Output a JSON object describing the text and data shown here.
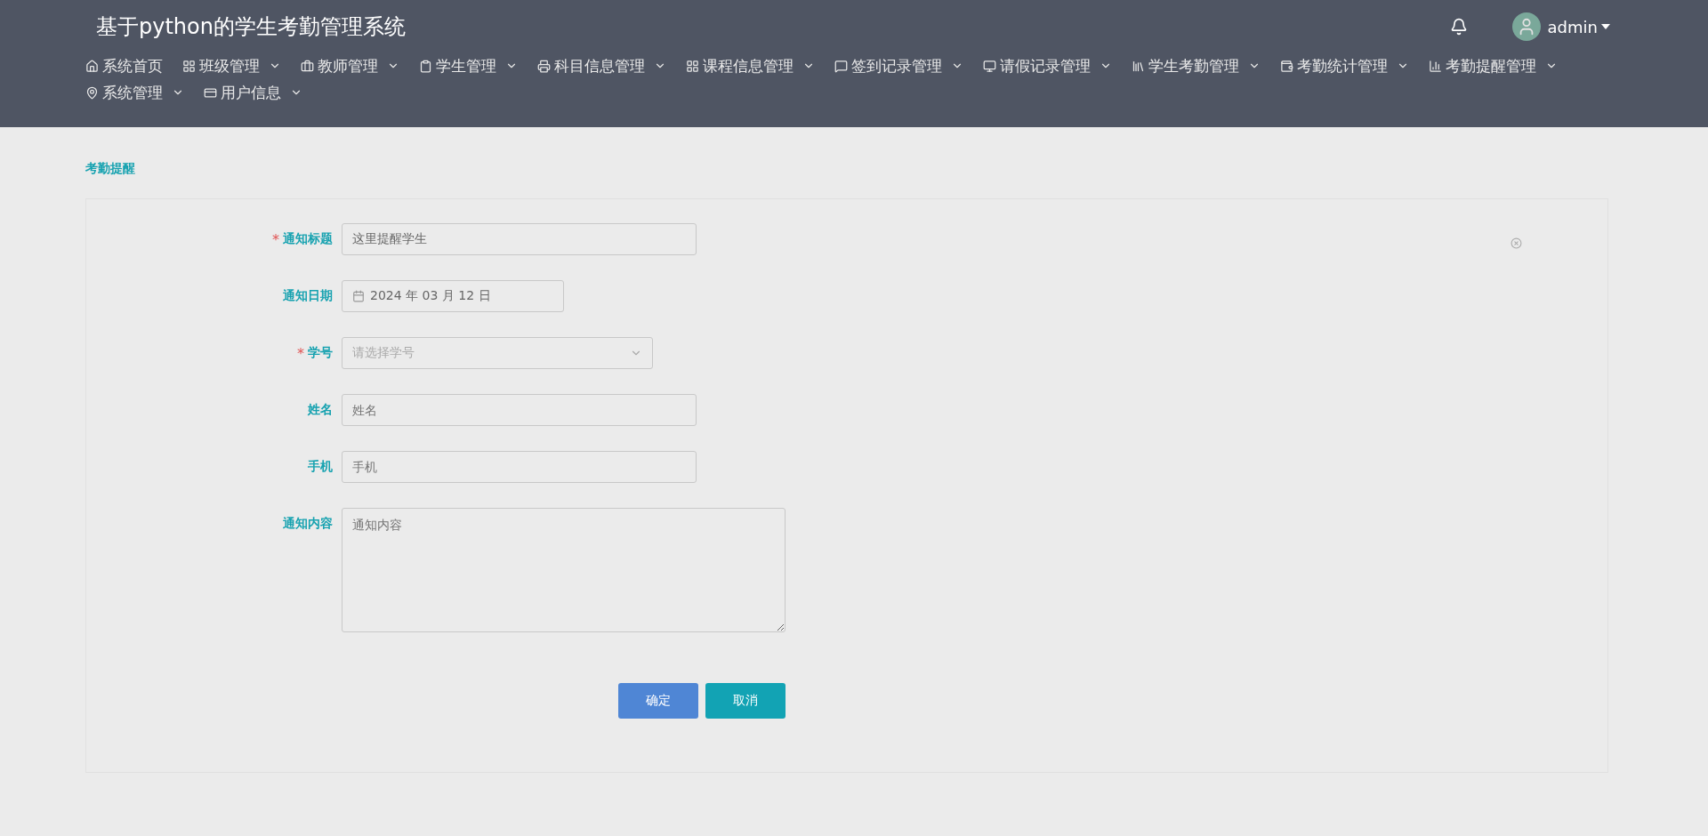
{
  "header": {
    "title": "基于python的学生考勤管理系统",
    "user": {
      "name": "admin"
    }
  },
  "nav": [
    {
      "label": "系统首页",
      "dropdown": false
    },
    {
      "label": "班级管理",
      "dropdown": true
    },
    {
      "label": "教师管理",
      "dropdown": true
    },
    {
      "label": "学生管理",
      "dropdown": true
    },
    {
      "label": "科目信息管理",
      "dropdown": true
    },
    {
      "label": "课程信息管理",
      "dropdown": true
    },
    {
      "label": "签到记录管理",
      "dropdown": true
    },
    {
      "label": "请假记录管理",
      "dropdown": true
    },
    {
      "label": "学生考勤管理",
      "dropdown": true
    },
    {
      "label": "考勤统计管理",
      "dropdown": true
    },
    {
      "label": "考勤提醒管理",
      "dropdown": true
    },
    {
      "label": "系统管理",
      "dropdown": true
    },
    {
      "label": "用户信息",
      "dropdown": true
    }
  ],
  "breadcrumb": "考勤提醒",
  "form": {
    "fields": [
      {
        "label": "通知标题",
        "kind": "text",
        "required_mark": "*",
        "value": "这里提醒学生",
        "clearable": true
      },
      {
        "label": "通知日期",
        "kind": "date",
        "value": "2024 年 03 月 12 日"
      },
      {
        "label": "学号",
        "kind": "select",
        "required_mark": "*",
        "placeholder": "请选择学号"
      },
      {
        "label": "姓名",
        "kind": "text",
        "placeholder": "姓名"
      },
      {
        "label": "手机",
        "kind": "text",
        "placeholder": "手机"
      },
      {
        "label": "通知内容",
        "kind": "textarea",
        "placeholder": "通知内容"
      }
    ],
    "buttons": [
      {
        "label": "确定",
        "kind": "primary"
      },
      {
        "label": "取消",
        "kind": "secondary"
      }
    ]
  }
}
